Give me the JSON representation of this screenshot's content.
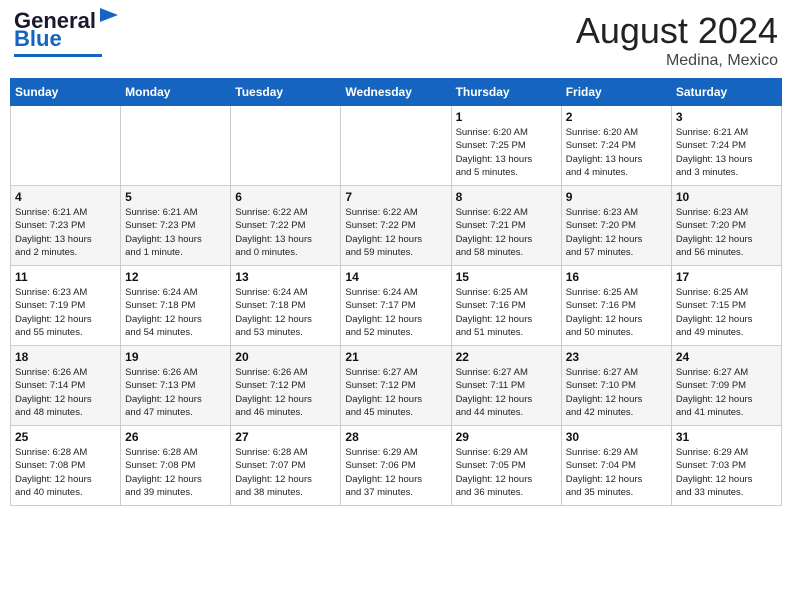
{
  "header": {
    "logo_line1": "General",
    "logo_line2": "Blue",
    "month_year": "August 2024",
    "location": "Medina, Mexico"
  },
  "calendar": {
    "days_of_week": [
      "Sunday",
      "Monday",
      "Tuesday",
      "Wednesday",
      "Thursday",
      "Friday",
      "Saturday"
    ],
    "weeks": [
      [
        {
          "day": "",
          "info": ""
        },
        {
          "day": "",
          "info": ""
        },
        {
          "day": "",
          "info": ""
        },
        {
          "day": "",
          "info": ""
        },
        {
          "day": "1",
          "info": "Sunrise: 6:20 AM\nSunset: 7:25 PM\nDaylight: 13 hours\nand 5 minutes."
        },
        {
          "day": "2",
          "info": "Sunrise: 6:20 AM\nSunset: 7:24 PM\nDaylight: 13 hours\nand 4 minutes."
        },
        {
          "day": "3",
          "info": "Sunrise: 6:21 AM\nSunset: 7:24 PM\nDaylight: 13 hours\nand 3 minutes."
        }
      ],
      [
        {
          "day": "4",
          "info": "Sunrise: 6:21 AM\nSunset: 7:23 PM\nDaylight: 13 hours\nand 2 minutes."
        },
        {
          "day": "5",
          "info": "Sunrise: 6:21 AM\nSunset: 7:23 PM\nDaylight: 13 hours\nand 1 minute."
        },
        {
          "day": "6",
          "info": "Sunrise: 6:22 AM\nSunset: 7:22 PM\nDaylight: 13 hours\nand 0 minutes."
        },
        {
          "day": "7",
          "info": "Sunrise: 6:22 AM\nSunset: 7:22 PM\nDaylight: 12 hours\nand 59 minutes."
        },
        {
          "day": "8",
          "info": "Sunrise: 6:22 AM\nSunset: 7:21 PM\nDaylight: 12 hours\nand 58 minutes."
        },
        {
          "day": "9",
          "info": "Sunrise: 6:23 AM\nSunset: 7:20 PM\nDaylight: 12 hours\nand 57 minutes."
        },
        {
          "day": "10",
          "info": "Sunrise: 6:23 AM\nSunset: 7:20 PM\nDaylight: 12 hours\nand 56 minutes."
        }
      ],
      [
        {
          "day": "11",
          "info": "Sunrise: 6:23 AM\nSunset: 7:19 PM\nDaylight: 12 hours\nand 55 minutes."
        },
        {
          "day": "12",
          "info": "Sunrise: 6:24 AM\nSunset: 7:18 PM\nDaylight: 12 hours\nand 54 minutes."
        },
        {
          "day": "13",
          "info": "Sunrise: 6:24 AM\nSunset: 7:18 PM\nDaylight: 12 hours\nand 53 minutes."
        },
        {
          "day": "14",
          "info": "Sunrise: 6:24 AM\nSunset: 7:17 PM\nDaylight: 12 hours\nand 52 minutes."
        },
        {
          "day": "15",
          "info": "Sunrise: 6:25 AM\nSunset: 7:16 PM\nDaylight: 12 hours\nand 51 minutes."
        },
        {
          "day": "16",
          "info": "Sunrise: 6:25 AM\nSunset: 7:16 PM\nDaylight: 12 hours\nand 50 minutes."
        },
        {
          "day": "17",
          "info": "Sunrise: 6:25 AM\nSunset: 7:15 PM\nDaylight: 12 hours\nand 49 minutes."
        }
      ],
      [
        {
          "day": "18",
          "info": "Sunrise: 6:26 AM\nSunset: 7:14 PM\nDaylight: 12 hours\nand 48 minutes."
        },
        {
          "day": "19",
          "info": "Sunrise: 6:26 AM\nSunset: 7:13 PM\nDaylight: 12 hours\nand 47 minutes."
        },
        {
          "day": "20",
          "info": "Sunrise: 6:26 AM\nSunset: 7:12 PM\nDaylight: 12 hours\nand 46 minutes."
        },
        {
          "day": "21",
          "info": "Sunrise: 6:27 AM\nSunset: 7:12 PM\nDaylight: 12 hours\nand 45 minutes."
        },
        {
          "day": "22",
          "info": "Sunrise: 6:27 AM\nSunset: 7:11 PM\nDaylight: 12 hours\nand 44 minutes."
        },
        {
          "day": "23",
          "info": "Sunrise: 6:27 AM\nSunset: 7:10 PM\nDaylight: 12 hours\nand 42 minutes."
        },
        {
          "day": "24",
          "info": "Sunrise: 6:27 AM\nSunset: 7:09 PM\nDaylight: 12 hours\nand 41 minutes."
        }
      ],
      [
        {
          "day": "25",
          "info": "Sunrise: 6:28 AM\nSunset: 7:08 PM\nDaylight: 12 hours\nand 40 minutes."
        },
        {
          "day": "26",
          "info": "Sunrise: 6:28 AM\nSunset: 7:08 PM\nDaylight: 12 hours\nand 39 minutes."
        },
        {
          "day": "27",
          "info": "Sunrise: 6:28 AM\nSunset: 7:07 PM\nDaylight: 12 hours\nand 38 minutes."
        },
        {
          "day": "28",
          "info": "Sunrise: 6:29 AM\nSunset: 7:06 PM\nDaylight: 12 hours\nand 37 minutes."
        },
        {
          "day": "29",
          "info": "Sunrise: 6:29 AM\nSunset: 7:05 PM\nDaylight: 12 hours\nand 36 minutes."
        },
        {
          "day": "30",
          "info": "Sunrise: 6:29 AM\nSunset: 7:04 PM\nDaylight: 12 hours\nand 35 minutes."
        },
        {
          "day": "31",
          "info": "Sunrise: 6:29 AM\nSunset: 7:03 PM\nDaylight: 12 hours\nand 33 minutes."
        }
      ]
    ]
  }
}
